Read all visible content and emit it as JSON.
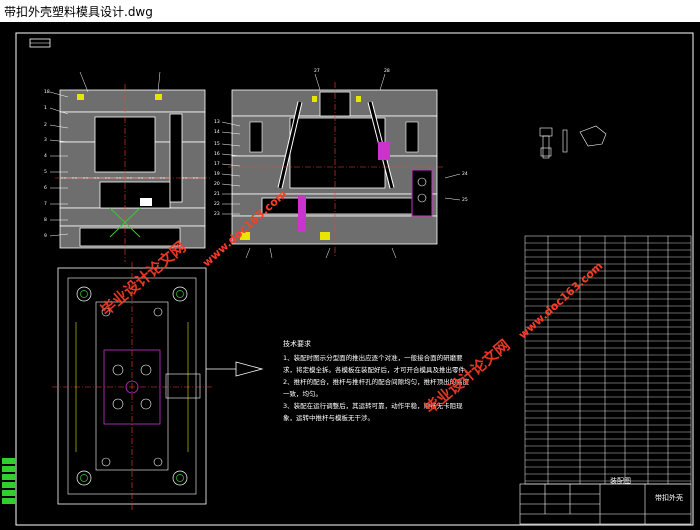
{
  "window": {
    "title": "带扣外壳塑料模具设计.dwg"
  },
  "drawing": {
    "tech_requirements": {
      "heading": "技术要求",
      "items": [
        "1、装配时图示分型面的推出应逐个对准，一般接合面的研磨要求，将定模全拆。各模板在装配好后，才可开合模具及推出零件。",
        "2、推杆的配合，推杆与推杆孔的配合间隙均匀，推杆顶出的高度一致，均匀。",
        "3、装配在运行调整后，其运转可靠，动作平稳，顺畅无卡阻现象，运转中推杆与模板无干涉。"
      ]
    },
    "title_block": {
      "name": "装配图",
      "label": "带扣外壳"
    },
    "watermark": {
      "text": "毕业设计论文网",
      "url": "www.doc163.com"
    },
    "colors": {
      "background": "#000000",
      "outline": "#ffffff",
      "section": "#6e6e6e",
      "accent_red": "#ff3c28",
      "accent_magenta": "#cc33cc",
      "accent_green": "#33cc33",
      "accent_yellow": "#e6e600"
    }
  }
}
